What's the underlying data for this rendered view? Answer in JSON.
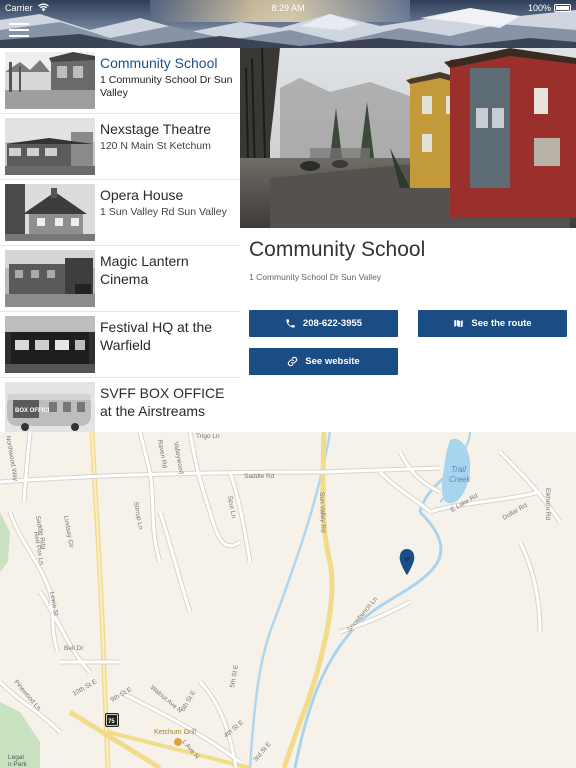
{
  "status_bar": {
    "carrier": "Carrier",
    "time": "8:29 AM",
    "battery": "100%"
  },
  "header": {
    "menu_icon": "hamburger-menu-icon"
  },
  "venues": [
    {
      "name": "Community School",
      "address": "1 Community School Dr Sun Valley",
      "active": true
    },
    {
      "name": "Nexstage Theatre",
      "address": "120 N Main St Ketchum"
    },
    {
      "name": "Opera House",
      "address": "1 Sun Valley Rd Sun Valley"
    },
    {
      "name": "Magic Lantern Cinema",
      "address": ""
    },
    {
      "name": "Festival HQ at the Warfield",
      "address": ""
    },
    {
      "name": "SVFF BOX OFFICE at the Airstreams",
      "address": "",
      "thumb_sign": "BOX OFFICE"
    }
  ],
  "detail": {
    "title": "Community School",
    "address": "1 Community School Dr Sun Valley",
    "phone_label": "208-622-3955",
    "route_label": "See the route",
    "website_label": "See website"
  },
  "map": {
    "lake_label_1": "Trail",
    "lake_label_2": "Creek",
    "poi_label": "Ketchum Grill",
    "highway_shield": "75",
    "corner_label_1": "Legal",
    "corner_label_2": "n Park",
    "streets": {
      "saddle_rd": "Saddle Rd",
      "sun_valley_rd": "Sun Valley Rd",
      "e_lake_rd": "E Lake Rd",
      "dollar_rd": "Dollar Rd",
      "elkhorn_rd": "Elkhorn Rd",
      "lindsay_cir": "Lindsay Cir",
      "red_fox_ln": "Red Fox Ln",
      "saddle_ridge": "Saddle Rdg",
      "lewis_st": "Lewis St",
      "bell_dr": "Bell Dr",
      "pinewood_ln": "Pinewood Ln",
      "tenth_st_e": "10th St E",
      "ninth_st_e": "9th St E",
      "walnut_ave_n": "Walnut Ave N",
      "sixth_st_e": "6th St E",
      "fifth_st_e": "5th St E",
      "fourth_st_e": "4th St E",
      "spur_ln": "Spur Ln",
      "stirrup_ln": "Stirrup Ln",
      "raven_rd": "Raven Rd",
      "valleywood": "Valleywood",
      "snowbunch_ln": "Snowbunch Ln",
      "northwood_way": "Northwood Way",
      "l_ave_n": "L Ave N",
      "trigo_ln": "Trigo Ln",
      "third_st_e": "3rd St E"
    }
  },
  "colors": {
    "accent": "#1b4d85",
    "active_title": "#1f4f8a",
    "map_bg": "#f6f2ea",
    "water": "#a8d4ee",
    "marker": "#1b4d85"
  }
}
